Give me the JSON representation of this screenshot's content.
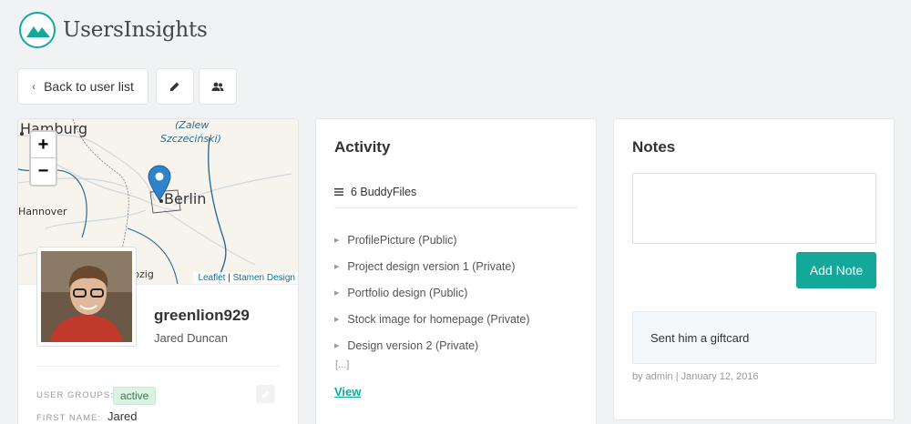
{
  "app": {
    "brand": "UsersInsights",
    "accent": "#14a89b"
  },
  "toolbar": {
    "back_label": "Back to user list",
    "edit_icon": "pencil-icon",
    "groups_icon": "users-icon"
  },
  "map": {
    "labels": {
      "hamburg": "Hamburg",
      "berlin": "Berlin",
      "hannover": "Hannover",
      "leipzig": "pzig",
      "zalew1": "(Zalew",
      "zalew2": "Szczeciński)"
    },
    "zoom_in": "+",
    "zoom_out": "−",
    "attribution_leaflet": "Leaflet",
    "attribution_sep": " | ",
    "attribution_stamen": "Stamen Design"
  },
  "profile": {
    "username": "greenlion929",
    "full_name": "Jared Duncan",
    "groups_label": "USER GROUPS:",
    "group_badge": "active",
    "first_name_label": "FIRST NAME:",
    "first_name": "Jared"
  },
  "activity": {
    "title": "Activity",
    "subheader": "6 BuddyFiles",
    "items": [
      "ProfilePicture (Public)",
      "Project design version 1 (Private)",
      "Portfolio design (Public)",
      "Stock image for homepage (Private)",
      "Design version 2 (Private)"
    ],
    "more": "[...]",
    "view_label": "View"
  },
  "notes": {
    "title": "Notes",
    "textarea_value": "",
    "add_label": "Add Note",
    "items": [
      {
        "text": "Sent him a giftcard",
        "meta": "by admin | January 12, 2016"
      }
    ]
  }
}
